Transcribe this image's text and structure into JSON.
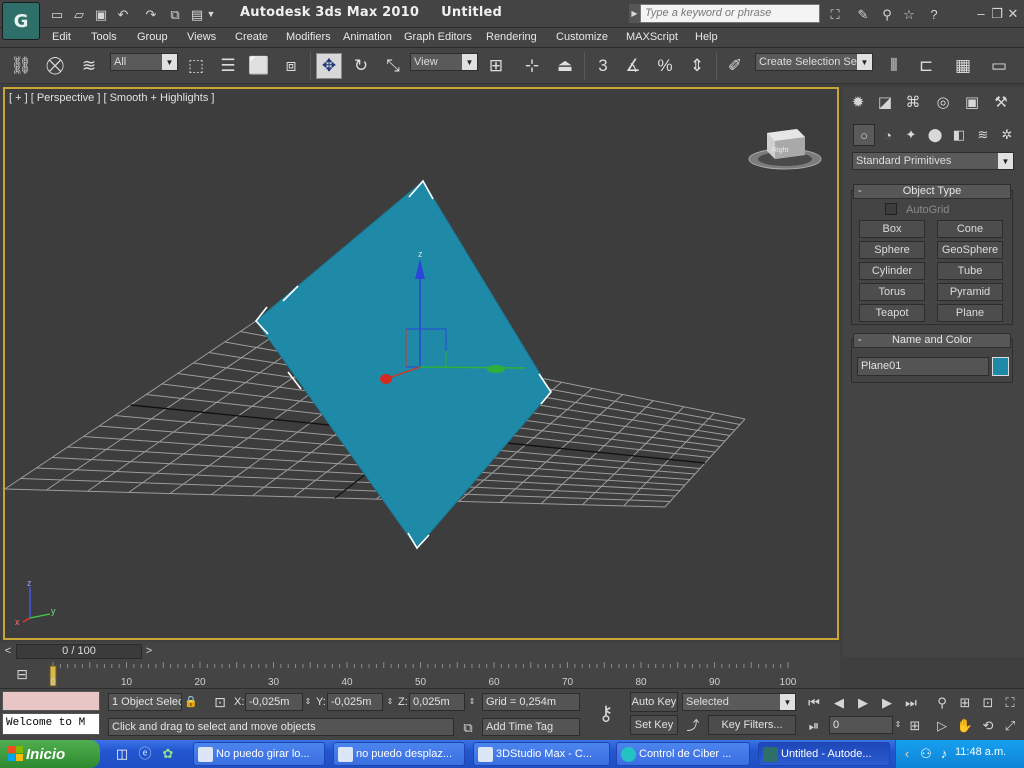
{
  "window": {
    "app_name": "Autodesk 3ds Max  2010",
    "doc_title": "Untitled",
    "search_placeholder": "Type a keyword or phrase"
  },
  "menu": [
    "Edit",
    "Tools",
    "Group",
    "Views",
    "Create",
    "Modifiers",
    "Animation",
    "Graph Editors",
    "Rendering",
    "Customize",
    "MAXScript",
    "Help"
  ],
  "toolbar": {
    "filter_value": "All",
    "ref_coord_value": "View",
    "selection_set_value": "Create Selection Se",
    "snap_label": "3"
  },
  "viewport": {
    "label": "[ + ] [ Perspective ] [ Smooth + Highlights ]",
    "viewcube_face": "Right",
    "gizmo_z_label": "z",
    "axis_tripod": {
      "z": "z",
      "x": "x",
      "y": "y"
    },
    "object_color": "#1f8aa8",
    "active_border_color": "#c8a534"
  },
  "command_panel": {
    "category_value": "Standard Primitives",
    "object_type": {
      "title": "Object Type",
      "autogrid_label": "AutoGrid",
      "buttons": [
        "Box",
        "Cone",
        "Sphere",
        "GeoSphere",
        "Cylinder",
        "Tube",
        "Torus",
        "Pyramid",
        "Teapot",
        "Plane"
      ]
    },
    "name_and_color": {
      "title": "Name and Color",
      "name_value": "Plane01",
      "color": "#1f8aa8"
    },
    "collapse_glyph": "-"
  },
  "timeline": {
    "slider_label": "0 / 100",
    "ticks": [
      "0",
      "10",
      "20",
      "30",
      "40",
      "50",
      "60",
      "70",
      "80",
      "90",
      "100"
    ],
    "left_arrow": "<",
    "right_arrow": ">"
  },
  "status": {
    "selection_info": "1 Object Selec",
    "prompt": "Click and drag to select and move objects",
    "x_label": "X:",
    "x_value": "-0,025m",
    "y_label": "Y:",
    "y_value": "-0,025m",
    "z_label": "Z:",
    "z_value": "0,025m",
    "grid_value": "Grid = 0,254m",
    "add_time_tag": "Add Time Tag",
    "auto_key": "Auto Key",
    "set_key": "Set Key",
    "key_mode_value": "Selected",
    "key_filters": "Key Filters...",
    "frame_value": "0",
    "maxscript_listener": "Welcome to M"
  },
  "taskbar": {
    "start_label": "Inicio",
    "tasks": [
      "No puedo girar lo...",
      "no puedo desplaz...",
      "3DStudio Max - C...",
      "Control de Ciber ...",
      "Untitled - Autode..."
    ],
    "clock": "11:48 a.m."
  }
}
